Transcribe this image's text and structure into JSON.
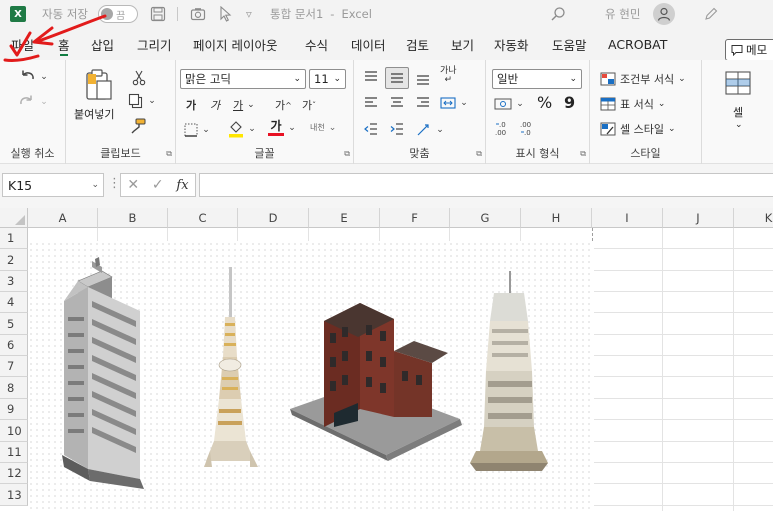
{
  "titlebar": {
    "autosave_label": "자동 저장",
    "autosave_state": "끔",
    "quick_access_more": "▿",
    "document_title": "통합 문서1",
    "title_separator": "-",
    "app_name": "Excel",
    "user_name": "유 현민"
  },
  "menu": {
    "items": [
      "파일",
      "홈",
      "삽입",
      "그리기",
      "페이지 레이아웃",
      "수식",
      "데이터",
      "검토",
      "보기",
      "자동화",
      "도움말",
      "ACROBAT"
    ],
    "active": "홈",
    "memo_label": "메모"
  },
  "ribbon": {
    "undo_group": {
      "label": "실행 취소"
    },
    "clipboard": {
      "label": "클립보드",
      "paste_label": "붙여넣기"
    },
    "font": {
      "label": "글꼴",
      "font_name": "맑은 고딕",
      "font_size": "11",
      "bold": "가",
      "italic": "가",
      "underline": "가",
      "grow": "가",
      "shrink": "가",
      "font_color_glyph": "가",
      "phonetic_glyph": "내천"
    },
    "alignment": {
      "label": "맞춤",
      "wrap_glyph": "가나"
    },
    "number": {
      "label": "표시 형식",
      "format": "일반",
      "percent": "%",
      "comma": "9"
    },
    "styles": {
      "label": "스타일",
      "conditional": "조건부 서식",
      "table": "표 서식",
      "cell_styles": "셀 스타일"
    },
    "cells": {
      "label": "셀"
    }
  },
  "formula_bar": {
    "name_box": "K15",
    "fx": "fx",
    "formula": ""
  },
  "grid": {
    "columns": [
      "A",
      "B",
      "C",
      "D",
      "E",
      "F",
      "G",
      "H",
      "I",
      "J",
      "K"
    ],
    "rows": [
      "1",
      "2",
      "3",
      "4",
      "5",
      "6",
      "7",
      "8",
      "9",
      "10",
      "11",
      "12",
      "13"
    ]
  },
  "picture": {
    "content": [
      "gray-highrise-building",
      "slender-tower",
      "brick-corner-building",
      "stacked-tower"
    ]
  },
  "annotation": {
    "color": "#e21b1b"
  }
}
